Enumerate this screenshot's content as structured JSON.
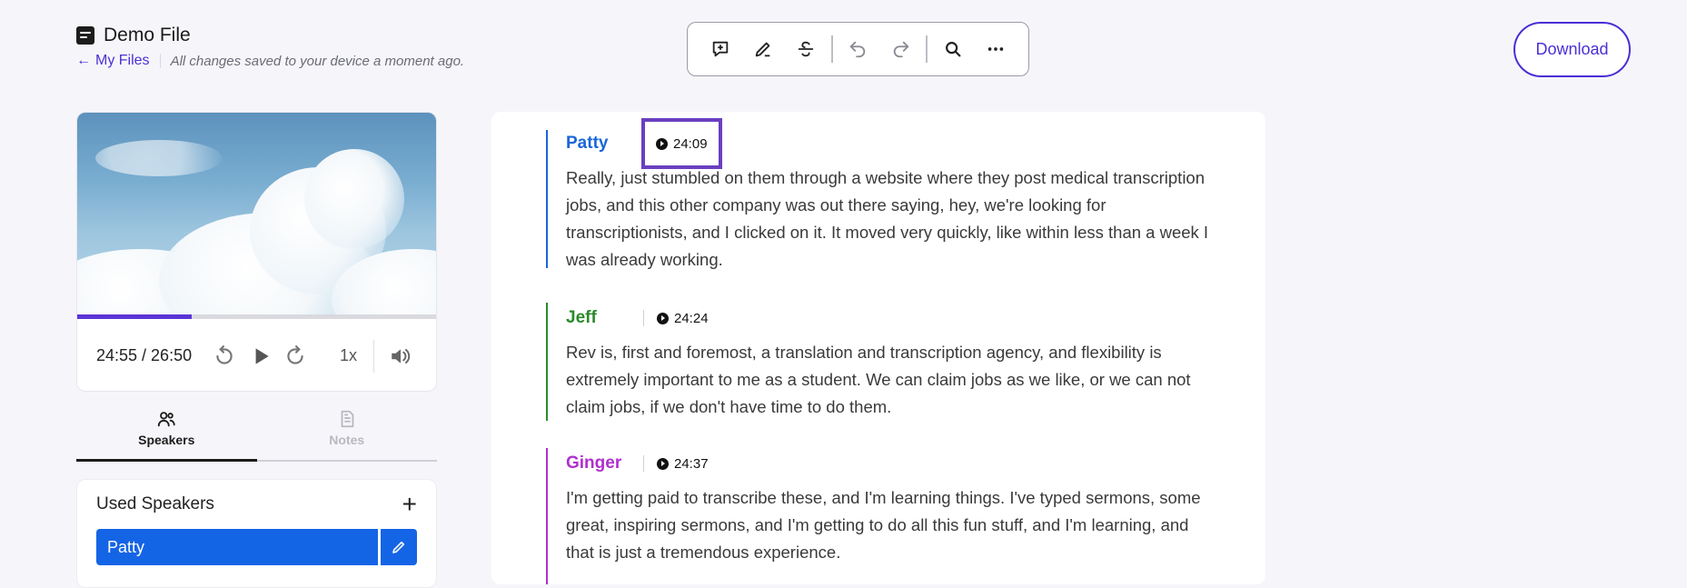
{
  "header": {
    "file_title": "Demo File",
    "back_label": "My Files",
    "save_status": "All changes saved to your device a moment ago."
  },
  "toolbar": {
    "buttons": [
      "add-comment-icon",
      "pencil-icon",
      "strikethrough-icon",
      "undo-icon",
      "redo-icon",
      "search-icon",
      "more-icon"
    ]
  },
  "download_label": "Download",
  "player": {
    "time": "24:55 / 26:50",
    "speed": "1x",
    "progress_fraction": 0.32
  },
  "tabs": [
    {
      "label": "Speakers",
      "active": true
    },
    {
      "label": "Notes",
      "active": false
    }
  ],
  "speakers_panel": {
    "title": "Used Speakers",
    "add": "+",
    "speakers": [
      "Patty"
    ]
  },
  "transcript": [
    {
      "speaker": "Patty",
      "color": "#1a66d9",
      "timestamp": "24:09",
      "highlight": true,
      "text": "Really, just stumbled on them through a website where they post medical transcription jobs, and this other company was out there saying, hey, we're looking for transcriptionists, and I clicked on it. It moved very quickly, like within less than a week I was already working."
    },
    {
      "speaker": "Jeff",
      "color": "#2b8a2b",
      "timestamp": "24:24",
      "highlight": false,
      "text": "Rev is, first and foremost, a translation and transcription agency, and flexibility is extremely important to me as a student. We can claim jobs as we like, or we can not claim jobs, if we don't have time to do them."
    },
    {
      "speaker": "Ginger",
      "color": "#b02fd0",
      "timestamp": "24:37",
      "highlight": false,
      "text": "I'm getting paid to transcribe these, and I'm learning things. I've typed sermons, some great, inspiring sermons, and I'm getting to do all this fun stuff, and I'm learning, and that is just a tremendous experience."
    }
  ]
}
